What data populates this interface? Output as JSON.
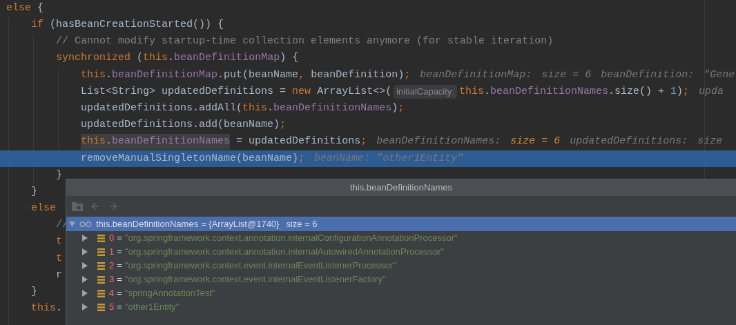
{
  "editor": {
    "lines": [
      {
        "current": false,
        "tokens": [
          {
            "kind": "keyword",
            "text": "else"
          },
          {
            "kind": "plain",
            "text": " {"
          }
        ]
      },
      {
        "current": false,
        "tokens": [
          {
            "kind": "keyword",
            "text": "    if"
          },
          {
            "kind": "plain",
            "text": " (hasBeanCreationStarted()) {"
          }
        ]
      },
      {
        "current": false,
        "tokens": [
          {
            "kind": "comment",
            "text": "        // Cannot modify startup-time collection elements anymore (for stable iteration)"
          }
        ]
      },
      {
        "current": false,
        "tokens": [
          {
            "kind": "keyword",
            "text": "        synchronized"
          },
          {
            "kind": "plain",
            "text": " ("
          },
          {
            "kind": "keyword",
            "text": "this"
          },
          {
            "kind": "plain",
            "text": "."
          },
          {
            "kind": "field",
            "text": "beanDefinitionMap"
          },
          {
            "kind": "plain",
            "text": ") {"
          }
        ]
      },
      {
        "current": false,
        "tokens": [
          {
            "kind": "keyword",
            "text": "            this"
          },
          {
            "kind": "plain",
            "text": "."
          },
          {
            "kind": "field",
            "text": "beanDefinitionMap"
          },
          {
            "kind": "plain",
            "text": ".put(beanName"
          },
          {
            "kind": "keyword",
            "text": ","
          },
          {
            "kind": "plain",
            "text": " beanDefinition)"
          },
          {
            "kind": "keyword",
            "text": ";"
          },
          {
            "kind": "hint",
            "text": "beanDefinitionMap:"
          },
          {
            "kind": "hint",
            "text": "size = 6"
          },
          {
            "kind": "hint",
            "text": "beanDefinition:"
          },
          {
            "kind": "hint",
            "text": "\"Gene"
          }
        ]
      },
      {
        "current": false,
        "tokens": [
          {
            "kind": "plain",
            "text": "            List<String> updatedDefinitions = "
          },
          {
            "kind": "keyword",
            "text": "new"
          },
          {
            "kind": "plain",
            "text": " ArrayList<>("
          },
          {
            "kind": "param_hint",
            "text": "initialCapacity:"
          },
          {
            "kind": "keyword",
            "text": "this"
          },
          {
            "kind": "plain",
            "text": "."
          },
          {
            "kind": "field",
            "text": "beanDefinitionNames"
          },
          {
            "kind": "plain",
            "text": ".size() + "
          },
          {
            "kind": "number",
            "text": "1"
          },
          {
            "kind": "plain",
            "text": ")"
          },
          {
            "kind": "keyword",
            "text": ";"
          },
          {
            "kind": "hint",
            "text": "upda"
          }
        ]
      },
      {
        "current": false,
        "tokens": [
          {
            "kind": "plain",
            "text": "            updatedDefinitions.addAll("
          },
          {
            "kind": "keyword",
            "text": "this"
          },
          {
            "kind": "plain",
            "text": "."
          },
          {
            "kind": "field",
            "text": "beanDefinitionNames"
          },
          {
            "kind": "plain",
            "text": ")"
          },
          {
            "kind": "keyword",
            "text": ";"
          }
        ]
      },
      {
        "current": false,
        "tokens": [
          {
            "kind": "plain",
            "text": "            updatedDefinitions.add(beanName)"
          },
          {
            "kind": "keyword",
            "text": ";"
          }
        ]
      },
      {
        "current": false,
        "tokens": [
          {
            "kind": "keyword",
            "text": "            this",
            "highlighted": true
          },
          {
            "kind": "plain",
            "text": ".",
            "highlighted": true
          },
          {
            "kind": "field",
            "text": "beanDefinitionNames",
            "highlighted": true
          },
          {
            "kind": "plain",
            "text": " = updatedDefinitions"
          },
          {
            "kind": "keyword",
            "text": ";"
          },
          {
            "kind": "hint",
            "text": "beanDefinitionNames:"
          },
          {
            "kind": "hint_changed",
            "text": "size = 6"
          },
          {
            "kind": "hint",
            "text": "updatedDefinitions:"
          },
          {
            "kind": "hint",
            "text": "size"
          }
        ]
      },
      {
        "current": true,
        "tokens": [
          {
            "kind": "plain",
            "text": "            removeManualSingletonName(beanName)"
          },
          {
            "kind": "keyword",
            "text": ";"
          },
          {
            "kind": "hint",
            "text": "beanName: \"other1Entity\""
          }
        ]
      },
      {
        "current": false,
        "tokens": [
          {
            "kind": "plain",
            "text": "        }"
          }
        ]
      },
      {
        "current": false,
        "tokens": [
          {
            "kind": "plain",
            "text": "    }"
          }
        ]
      },
      {
        "current": false,
        "tokens": [
          {
            "kind": "keyword",
            "text": "    else"
          }
        ]
      },
      {
        "current": false,
        "tokens": [
          {
            "kind": "comment",
            "text": "        //"
          }
        ]
      },
      {
        "current": false,
        "tokens": [
          {
            "kind": "keyword",
            "text": "        t"
          }
        ]
      },
      {
        "current": false,
        "tokens": [
          {
            "kind": "keyword",
            "text": "        t"
          }
        ]
      },
      {
        "current": false,
        "tokens": [
          {
            "kind": "plain",
            "text": "        r"
          }
        ]
      },
      {
        "current": false,
        "tokens": [
          {
            "kind": "plain",
            "text": "    }"
          }
        ]
      },
      {
        "current": false,
        "tokens": [
          {
            "kind": "keyword",
            "text": "    this"
          },
          {
            "kind": "plain",
            "text": "."
          }
        ]
      }
    ]
  },
  "popup": {
    "title": "this.beanDefinitionNames",
    "toolbar": [
      {
        "kind": "folder",
        "disabled": true
      },
      {
        "kind": "back",
        "disabled": true
      },
      {
        "kind": "forward",
        "disabled": true
      }
    ],
    "root": {
      "name": "this.beanDefinitionNames",
      "value": "= {ArrayList@1740}",
      "size": "size = 6",
      "expanded": true,
      "selected": true,
      "children": [
        {
          "index": "0",
          "operator": "=",
          "value": "\"org.springframework.context.annotation.internalConfigurationAnnotationProcessor\"",
          "expanded": false,
          "selected": false
        },
        {
          "index": "1",
          "operator": "=",
          "value": "\"org.springframework.context.annotation.internalAutowiredAnnotationProcessor\"",
          "expanded": false,
          "selected": false
        },
        {
          "index": "2",
          "operator": "=",
          "value": "\"org.springframework.context.event.internalEventListenerProcessor\"",
          "expanded": false,
          "selected": false
        },
        {
          "index": "3",
          "operator": "=",
          "value": "\"org.springframework.context.event.internalEventListenerFactory\"",
          "expanded": false,
          "selected": false
        },
        {
          "index": "4",
          "operator": "=",
          "value": "\"springAnnotationTest\"",
          "expanded": false,
          "selected": false
        },
        {
          "index": "5",
          "operator": "=",
          "value": "\"other1Entity\"",
          "expanded": false,
          "selected": false
        }
      ]
    }
  }
}
